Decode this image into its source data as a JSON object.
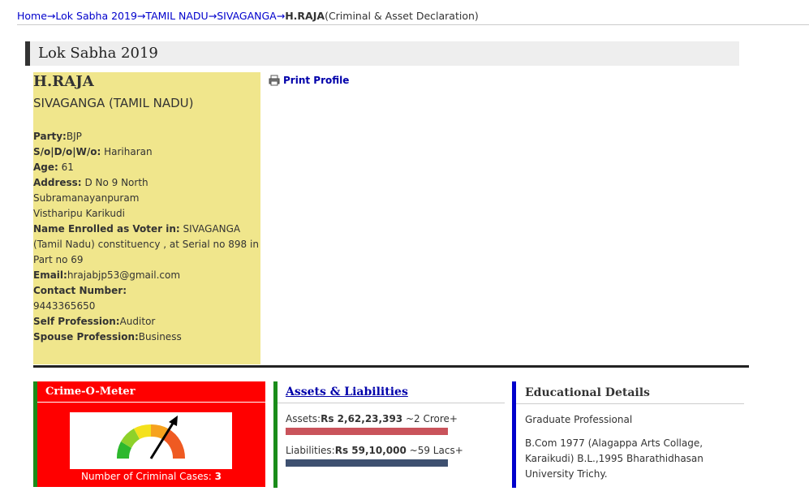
{
  "breadcrumb": {
    "items": [
      "Home",
      "Lok Sabha 2019",
      "TAMIL NADU",
      "SIVAGANGA"
    ],
    "separator": "→",
    "current": "H.RAJA",
    "suffix": "(Criminal & Asset Declaration)"
  },
  "section": {
    "title": "Lok Sabha 2019"
  },
  "print": {
    "label": "Print Profile",
    "icon": "printer-icon"
  },
  "profile": {
    "name": "H.RAJA",
    "constituency": "SIVAGANGA (TAMIL NADU)",
    "party_label": "Party:",
    "party": "BJP",
    "relation_label": "S/o|D/o|W/o:",
    "relation": "Hariharan",
    "age_label": "Age:",
    "age": "61",
    "address_label": "Address:",
    "address_line1": "D No 9 North",
    "address_line2": "Subramanayanpuram",
    "address_line3": "Vistharipu Karikudi",
    "voter_label": "Name Enrolled as Voter in:",
    "voter": "SIVAGANGA (Tamil Nadu) constituency , at Serial no 898 in Part no 69",
    "email_label": "Email:",
    "email": "hrajabjp53@gmail.com",
    "contact_label": "Contact Number:",
    "contact": "9443365650",
    "self_prof_label": "Self Profession:",
    "self_prof": "Auditor",
    "spouse_prof_label": "Spouse Profession:",
    "spouse_prof": "Business"
  },
  "crime": {
    "title": "Crime-O-Meter",
    "cases_label": "Number of Criminal Cases:",
    "cases": "3",
    "gauge_colors": [
      "#2db82d",
      "#8ed12a",
      "#f4e11c",
      "#f6a21e",
      "#ef5a22"
    ]
  },
  "assets": {
    "title": "Assets & Liabilities",
    "assets_label": "Assets:",
    "assets_value": "Rs 2,62,23,393",
    "assets_approx": "~2 Crore+",
    "liab_label": "Liabilities:",
    "liab_value": "Rs 59,10,000",
    "liab_approx": "~59 Lacs+"
  },
  "education": {
    "title": "Educational Details",
    "level": "Graduate Professional",
    "details": "B.Com 1977 (Alagappa Arts Collage, Karaikudi) B.L.,1995 Bharathidhasan University Trichy."
  }
}
